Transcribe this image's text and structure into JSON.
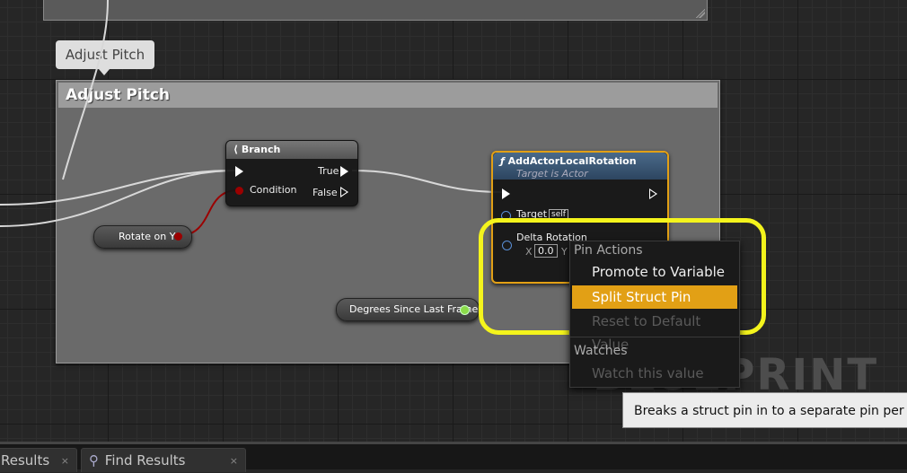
{
  "comment_bubble": "Adjust Pitch",
  "comment_title": "Adjust Pitch",
  "branch_node": {
    "title": "Branch",
    "condition": "Condition",
    "true": "True",
    "false": "False"
  },
  "rotation_node": {
    "title": "AddActorLocalRotation",
    "subtitle": "Target is Actor",
    "target": "Target",
    "target_value": "self",
    "delta": "Delta Rotation",
    "x_label": "X",
    "x_value": "0.0",
    "y_label": "Y"
  },
  "var_rotate": "Rotate on Y",
  "var_degrees": "Degrees Since Last Frame",
  "context_menu": {
    "section_pin_actions": "Pin Actions",
    "promote": "Promote to Variable",
    "split": "Split Struct Pin",
    "reset": "Reset to Default Value",
    "section_watches": "Watches",
    "watch": "Watch this value"
  },
  "watermark": "BLUEPRINT",
  "tooltip": "Breaks a struct pin in to a separate pin per e",
  "tabs": {
    "results": "Results",
    "find_results": "Find Results"
  },
  "colors": {
    "highlight": "#f4f41c",
    "selected": "#e2a015",
    "bool_pin": "#9b0000",
    "float_pin": "#8bdb4a",
    "struct_pin": "#5a8fd6"
  }
}
